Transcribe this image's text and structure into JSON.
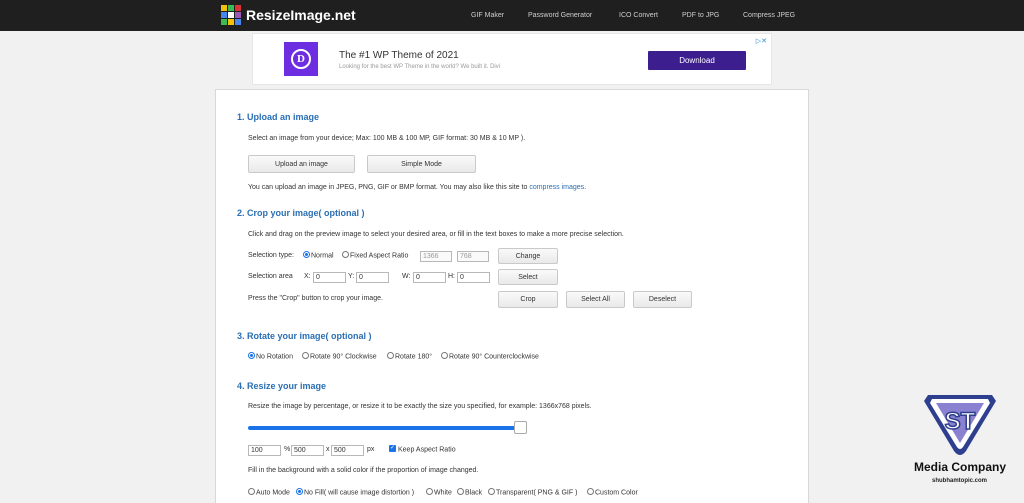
{
  "header": {
    "site_name": "ResizeImage.net",
    "nav": [
      "GIF Maker",
      "Password Generator",
      "ICO Convert",
      "PDF to JPG",
      "Compress JPEG"
    ]
  },
  "ad": {
    "logo_letter": "D",
    "title": "The #1 WP Theme of 2021",
    "subtitle": "Looking for the best WP Theme in the world? We built it. Divi",
    "button": "Download",
    "close_icon": "ad-choices-close"
  },
  "step1": {
    "title": "1. Upload an image",
    "desc": "Select an image from your device; Max: 100 MB & 100 MP, GIF format: 30 MB & 10 MP ).",
    "upload_button": "Upload an image",
    "simple_mode_button": "Simple Mode",
    "note": "You can upload an image in JPEG, PNG, GIF or BMP format. You may also like this site to",
    "note_link": "compress images",
    "note_end": "."
  },
  "step2": {
    "title": "2. Crop your image( optional )",
    "desc": "Click and drag on the preview image to select your desired area, or fill in the text boxes to make a more precise selection.",
    "selection_type_label": "Selection type:",
    "normal_label": "Normal",
    "fixed_label": "Fixed Aspect Ratio",
    "ratio_w": "1366",
    "ratio_h": "768",
    "change_button": "Change",
    "selection_area_label": "Selection area",
    "x_label": "X:",
    "x_value": "0",
    "y_label": "Y:",
    "y_value": "0",
    "w_label": "W:",
    "w_value": "0",
    "h_label": "H:",
    "h_value": "0",
    "select_button": "Select",
    "crop_hint": "Press the \"Crop\" button to crop your image.",
    "crop_button": "Crop",
    "select_all_button": "Select All",
    "deselect_button": "Deselect"
  },
  "step3": {
    "title": "3. Rotate your image( optional )",
    "options": [
      "No Rotation",
      "Rotate 90° Clockwise",
      "Rotate 180°",
      "Rotate 90° Counterclockwise"
    ],
    "selected": 0
  },
  "step4": {
    "title": "4. Resize your image",
    "desc": "Resize the image by percentage, or resize it to be exactly the size you specified, for example: 1366x768 pixels.",
    "slider_percent": 100,
    "percent_value": "100",
    "percent_unit": "%",
    "width_value": "500",
    "x_sep": "x",
    "height_value": "500",
    "px_unit": "px",
    "keep_aspect_label": "Keep Aspect Ratio",
    "bg_desc": "Fill in the background with a solid color if the proportion of image changed.",
    "bg_options": [
      "Auto Mode",
      "No Fill( will cause image distortion )",
      "White",
      "Black",
      "Transparent( PNG & GIF )",
      "Custom Color"
    ],
    "bg_selected": 1
  },
  "watermark": {
    "logo_text": "ST",
    "company": "Media Company",
    "url": "shubhamtopic.com"
  },
  "colors": {
    "topbar": "#1f1f1f",
    "heading": "#2a6fb3",
    "accent": "#1a73e8",
    "ad_button": "#3d1e8f",
    "ad_logo": "#6d2de0"
  }
}
